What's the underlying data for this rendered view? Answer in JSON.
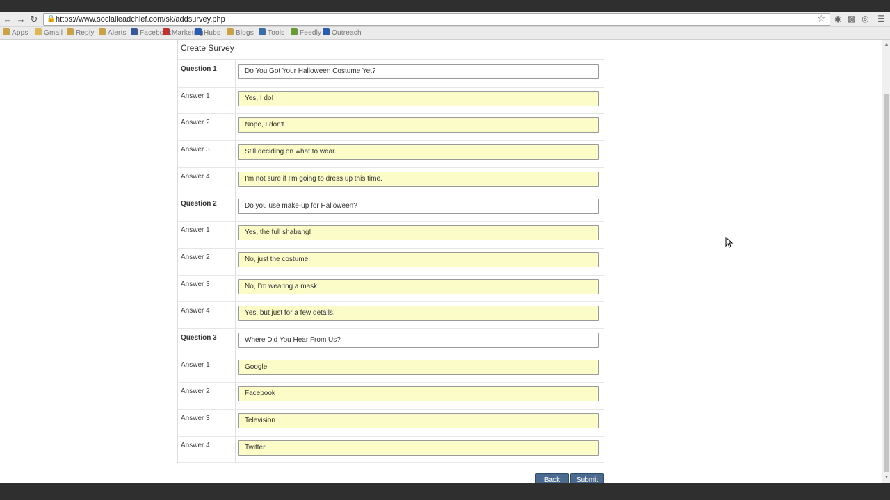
{
  "browser": {
    "url": "https://www.socialleadchief.com/sk/addsurvey.php",
    "bookmarks": [
      "Apps",
      "Gmail",
      "Reply",
      "Alerts",
      "Facebook",
      "Marketing",
      "Hubs",
      "Blogs",
      "Tools",
      "Feedly",
      "Outreach"
    ]
  },
  "form": {
    "title": "Create Survey",
    "rows": [
      {
        "label": "Question 1",
        "value": "Do You Got Your Halloween Costume Yet?",
        "kind": "question"
      },
      {
        "label": "Answer 1",
        "value": "Yes, I do!",
        "kind": "answer"
      },
      {
        "label": "Answer 2",
        "value": "Nope, I don't.",
        "kind": "answer"
      },
      {
        "label": "Answer 3",
        "value": "Still deciding on what to wear.",
        "kind": "answer"
      },
      {
        "label": "Answer 4",
        "value": "I'm not sure if I'm going to dress up this time.",
        "kind": "answer"
      },
      {
        "label": "Question 2",
        "value": "Do you use make-up for Halloween?",
        "kind": "question"
      },
      {
        "label": "Answer 1",
        "value": "Yes, the full shabang!",
        "kind": "answer"
      },
      {
        "label": "Answer 2",
        "value": "No, just the costume.",
        "kind": "answer"
      },
      {
        "label": "Answer 3",
        "value": "No, I'm wearing a mask.",
        "kind": "answer"
      },
      {
        "label": "Answer 4",
        "value": "Yes, but just for a few details.",
        "kind": "answer"
      },
      {
        "label": "Question 3",
        "value": "Where Did You Hear From Us?",
        "kind": "question"
      },
      {
        "label": "Answer 1",
        "value": "Google",
        "kind": "answer"
      },
      {
        "label": "Answer 2",
        "value": "Facebook",
        "kind": "answer"
      },
      {
        "label": "Answer 3",
        "value": "Television",
        "kind": "answer"
      },
      {
        "label": "Answer 4",
        "value": "Twitter",
        "kind": "answer"
      }
    ]
  },
  "actions": {
    "back_label": "Back",
    "submit_label": "Submit"
  }
}
